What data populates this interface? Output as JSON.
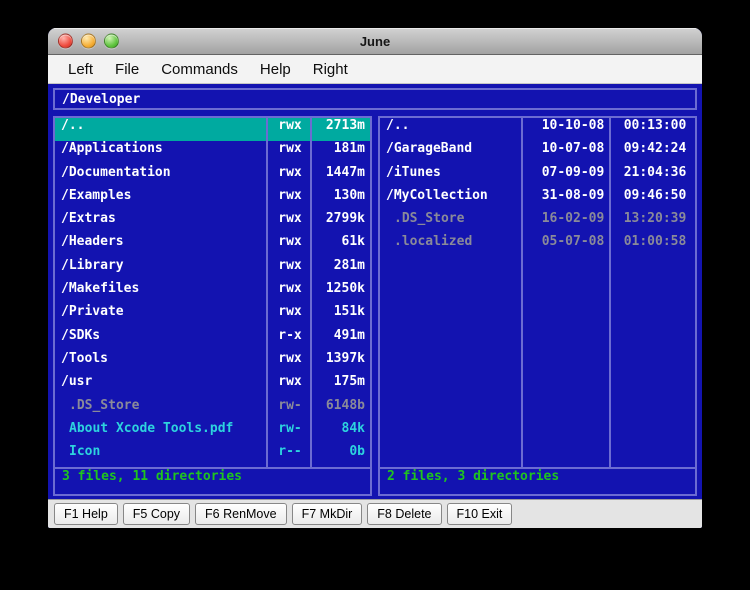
{
  "window": {
    "title": "June"
  },
  "menu": {
    "items": [
      "Left",
      "File",
      "Commands",
      "Help",
      "Right"
    ]
  },
  "path_bar": {
    "path": "/Developer"
  },
  "left_pane": {
    "columns": [
      "name",
      "permissions",
      "size"
    ],
    "rows": [
      {
        "name": "/..",
        "perm": "rwx",
        "size": "2713m",
        "type": "dir",
        "selected": true
      },
      {
        "name": "/Applications",
        "perm": "rwx",
        "size": "181m",
        "type": "dir"
      },
      {
        "name": "/Documentation",
        "perm": "rwx",
        "size": "1447m",
        "type": "dir"
      },
      {
        "name": "/Examples",
        "perm": "rwx",
        "size": "130m",
        "type": "dir"
      },
      {
        "name": "/Extras",
        "perm": "rwx",
        "size": "2799k",
        "type": "dir"
      },
      {
        "name": "/Headers",
        "perm": "rwx",
        "size": "61k",
        "type": "dir"
      },
      {
        "name": "/Library",
        "perm": "rwx",
        "size": "281m",
        "type": "dir"
      },
      {
        "name": "/Makefiles",
        "perm": "rwx",
        "size": "1250k",
        "type": "dir"
      },
      {
        "name": "/Private",
        "perm": "rwx",
        "size": "151k",
        "type": "dir"
      },
      {
        "name": "/SDKs",
        "perm": "r-x",
        "size": "491m",
        "type": "dir"
      },
      {
        "name": "/Tools",
        "perm": "rwx",
        "size": "1397k",
        "type": "dir"
      },
      {
        "name": "/usr",
        "perm": "rwx",
        "size": "175m",
        "type": "dir"
      },
      {
        "name": ".DS_Store",
        "perm": "rw-",
        "size": "6148b",
        "type": "hidden"
      },
      {
        "name": "About Xcode Tools.pdf",
        "perm": "rw-",
        "size": "84k",
        "type": "file"
      },
      {
        "name": "Icon",
        "perm": "r--",
        "size": "0b",
        "type": "file"
      }
    ],
    "status": "3 files, 11 directories"
  },
  "right_pane": {
    "columns": [
      "name",
      "date",
      "time"
    ],
    "rows": [
      {
        "name": "/..",
        "date": "10-10-08",
        "time": "00:13:00",
        "type": "dir"
      },
      {
        "name": "/GarageBand",
        "date": "10-07-08",
        "time": "09:42:24",
        "type": "dir"
      },
      {
        "name": "/iTunes",
        "date": "07-09-09",
        "time": "21:04:36",
        "type": "dir"
      },
      {
        "name": "/MyCollection",
        "date": "31-08-09",
        "time": "09:46:50",
        "type": "dir"
      },
      {
        "name": ".DS_Store",
        "date": "16-02-09",
        "time": "13:20:39",
        "type": "hidden"
      },
      {
        "name": ".localized",
        "date": "05-07-08",
        "time": "01:00:58",
        "type": "hidden"
      }
    ],
    "status": "2 files, 3 directories"
  },
  "function_bar": {
    "buttons": [
      "F1 Help",
      "F5 Copy",
      "F6 RenMove",
      "F7 MkDir",
      "F8 Delete",
      "F10 Exit"
    ]
  },
  "colors": {
    "background_blue": "#1313b0",
    "pane_border": "#6c6cd2",
    "selection_teal": "#00aaa0",
    "directory_text": "#ffffff",
    "file_text": "#2dd3de",
    "hidden_text": "#8a8a99",
    "status_green": "#1fc41f"
  }
}
